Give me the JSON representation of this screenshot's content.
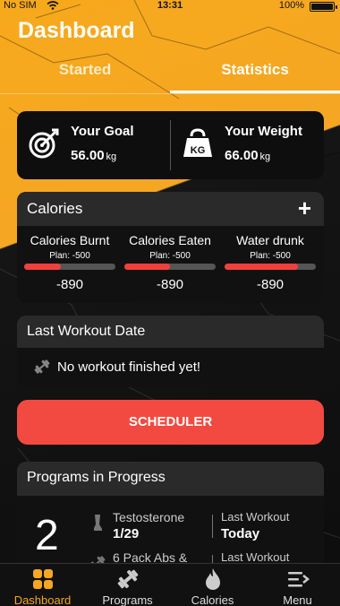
{
  "status_bar": {
    "carrier": "No SIM",
    "time": "13:31",
    "battery": "100%"
  },
  "header": {
    "title": "Dashboard",
    "tabs": [
      {
        "label": "Started"
      },
      {
        "label": "Statistics"
      }
    ]
  },
  "goal": {
    "your_goal_label": "Your Goal",
    "your_goal_value": "56.00",
    "your_goal_unit": "kg",
    "your_weight_label": "Your Weight",
    "your_weight_value": "66.00",
    "your_weight_unit": "kg",
    "weight_icon_text": "KG"
  },
  "calories": {
    "title": "Calories",
    "add_label": "+",
    "columns": [
      {
        "name": "Calories Burnt",
        "plan": "Plan: -500",
        "value": "-890",
        "fill": 0.4
      },
      {
        "name": "Calories Eaten",
        "plan": "Plan: -500",
        "value": "-890",
        "fill": 0.5
      },
      {
        "name": "Water drunk",
        "plan": "Plan: -500",
        "value": "-890",
        "fill": 0.8
      }
    ]
  },
  "last_workout": {
    "title": "Last Workout Date",
    "message": "No workout finished yet!"
  },
  "scheduler": {
    "label": "SCHEDULER"
  },
  "programs": {
    "title": "Programs in Progress",
    "count": "2",
    "items": [
      {
        "name": "Testosterone",
        "progress": "1/29",
        "last_label": "Last Workout",
        "last_value": "Today"
      },
      {
        "name": "6 Pack Abs &",
        "progress": "",
        "last_label": "Last Workout",
        "last_value": ""
      }
    ]
  },
  "bottom_nav": [
    {
      "label": "Dashboard",
      "icon": "dashboard-icon"
    },
    {
      "label": "Programs",
      "icon": "dumbbell-icon"
    },
    {
      "label": "Calories",
      "icon": "flame-icon"
    },
    {
      "label": "Menu",
      "icon": "menu-icon"
    }
  ],
  "colors": {
    "accent": "#f5a623",
    "danger": "#f24a40",
    "card": "#0e0e0e"
  }
}
